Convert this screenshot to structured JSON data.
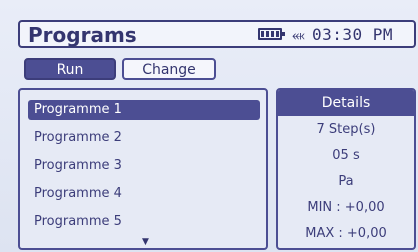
{
  "header": {
    "title": "Programs",
    "battery_icon": "battery-full-icon",
    "plug_icon": "plug-icon",
    "time": "03:30 PM"
  },
  "tabs": [
    {
      "label": "Run",
      "active": true
    },
    {
      "label": "Change",
      "active": false
    }
  ],
  "programs": [
    {
      "label": "Programme 1",
      "selected": true
    },
    {
      "label": "Programme 2",
      "selected": false
    },
    {
      "label": "Programme 3",
      "selected": false
    },
    {
      "label": "Programme 4",
      "selected": false
    },
    {
      "label": "Programme 5",
      "selected": false
    }
  ],
  "list_scroll_icon": "arrow-down-icon",
  "details": {
    "header": "Details",
    "steps": "7 Step(s)",
    "duration": "05 s",
    "unit": "Pa",
    "min": "MIN : +0,00",
    "max": "MAX : +0,00"
  },
  "colors": {
    "accent": "#4c4e93",
    "text": "#34356f",
    "background": "#e6eaf5"
  }
}
